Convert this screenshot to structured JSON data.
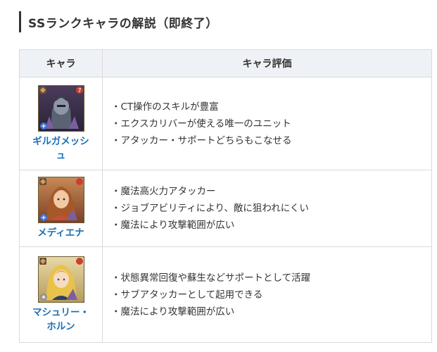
{
  "heading": {
    "title": "SSランクキャラの解説（即終了）"
  },
  "table": {
    "headers": {
      "chara": "キャラ",
      "evaluation": "キャラ評価"
    },
    "rows": [
      {
        "name_line1": "ギルガメッシ",
        "name_line2": "ュ",
        "points": [
          "CT操作のスキルが豊富",
          "エクスカリバーが使える唯一のユニット",
          "アタッカー・サポートどちらもこなせる"
        ]
      },
      {
        "name_line1": "メディエナ",
        "points": [
          "魔法高火力アタッカー",
          "ジョブアビリティにより、敵に狙われにくい",
          "魔法により攻撃範囲が広い"
        ]
      },
      {
        "name_line1": "マシュリー・",
        "name_line2": "ホルン",
        "points": [
          "状態異常回復や蘇生などサポートとして活躍",
          "サブアタッカーとして起用できる",
          "魔法により攻撃範囲が広い"
        ]
      }
    ]
  },
  "colors": {
    "link": "#1a6fb5",
    "header_bg": "#eef2f6",
    "border": "#d9d9d9",
    "text": "#333333"
  }
}
